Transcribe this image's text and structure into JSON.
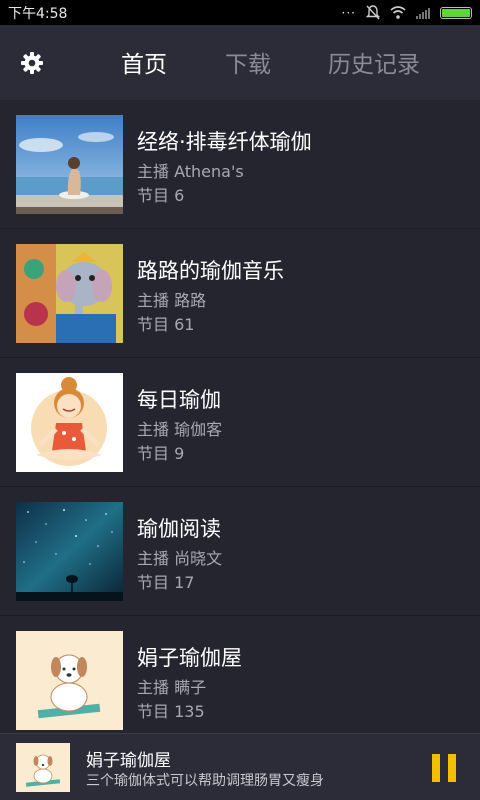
{
  "status_bar": {
    "time": "下午4:58",
    "battery_color": "#5fd53b"
  },
  "header": {
    "settings_icon": "gear-icon",
    "tabs": [
      {
        "label": "首页",
        "active": true
      },
      {
        "label": "下载",
        "active": false
      },
      {
        "label": "历史记录",
        "active": false
      }
    ]
  },
  "programs": [
    {
      "title": "经络·排毒纤体瑜伽",
      "host_label": "主播 Athena's",
      "episodes_label": "节目 6",
      "thumbnail": "woman-meditating-by-sea"
    },
    {
      "title": "路路的瑜伽音乐",
      "host_label": "主播 路路",
      "episodes_label": "节目 61",
      "thumbnail": "ganesha-painting"
    },
    {
      "title": "每日瑜伽",
      "host_label": "主播 瑜伽客",
      "episodes_label": "节目 9",
      "thumbnail": "cartoon-girl-lotus-pose"
    },
    {
      "title": "瑜伽阅读",
      "host_label": "主播 尚晓文",
      "episodes_label": "节目 17",
      "thumbnail": "starry-sky-tree"
    },
    {
      "title": "娟子瑜伽屋",
      "host_label": "主播 瞒子",
      "episodes_label": "节目 135",
      "thumbnail": "cartoon-dog-yoga"
    }
  ],
  "now_playing": {
    "title": "娟子瑜伽屋",
    "subtitle": "三个瑜伽体式可以帮助调理肠胃又瘦身",
    "control_icon": "pause-icon",
    "accent_color": "#f2c000"
  }
}
